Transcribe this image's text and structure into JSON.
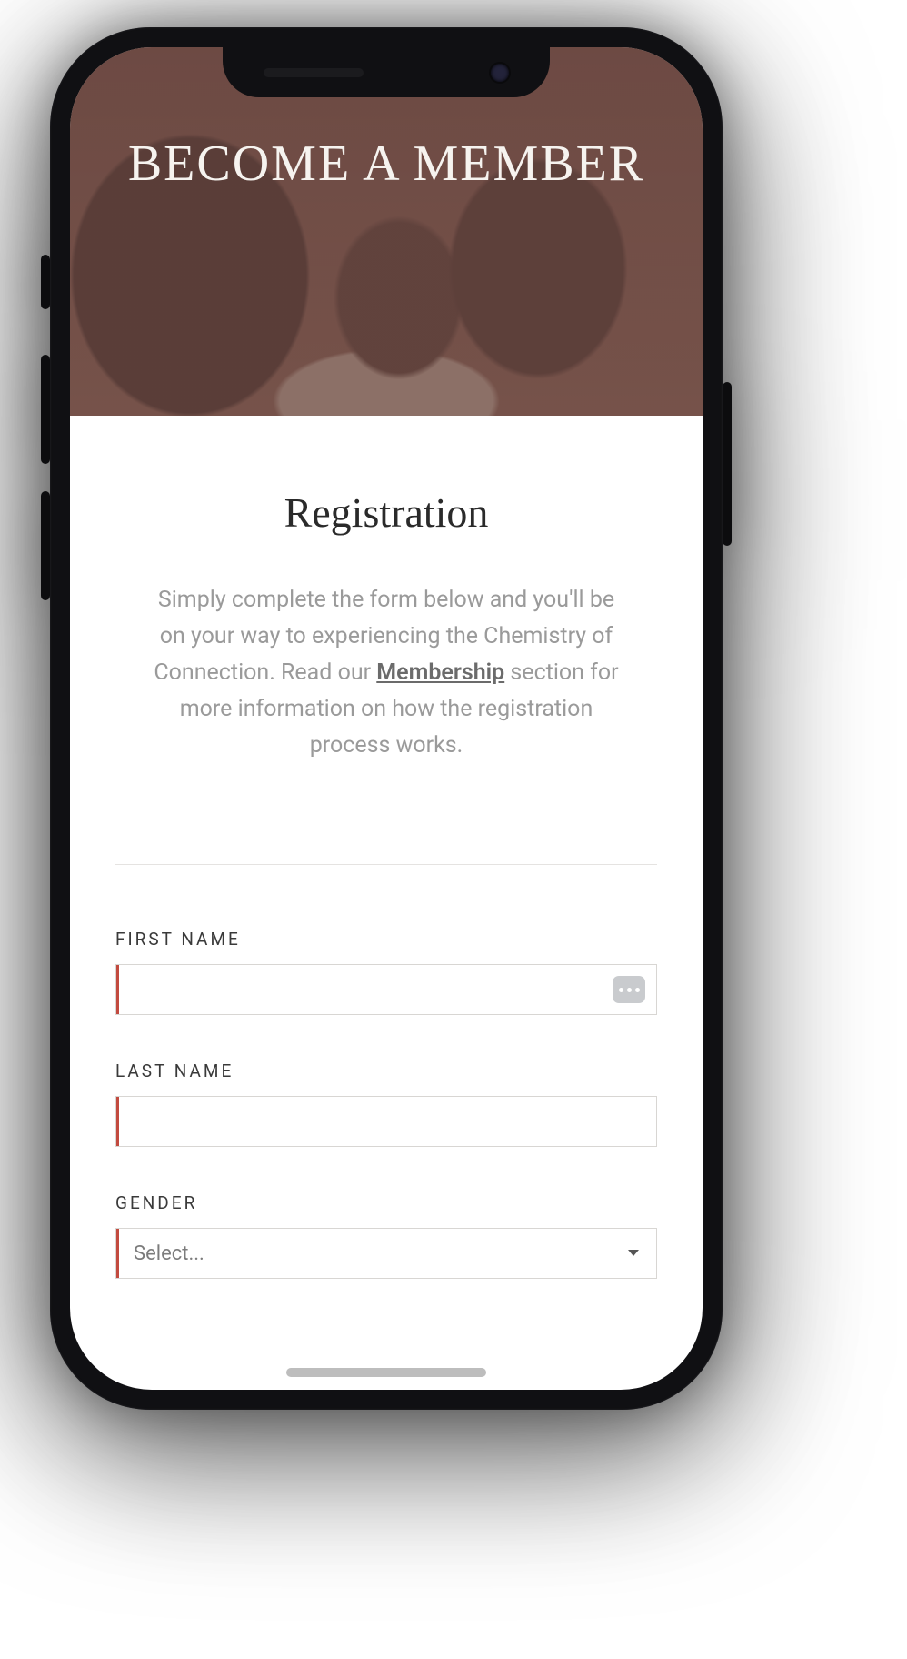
{
  "hero": {
    "title": "BECOME A MEMBER"
  },
  "section": {
    "title": "Registration",
    "intro_before_link": "Simply complete the form below and you'll be on your way to experiencing the Chemistry of Connection. Read our ",
    "link_text": "Membership",
    "intro_after_link": " section for more information on how the registration process works."
  },
  "form": {
    "first_name": {
      "label": "FIRST NAME",
      "value": ""
    },
    "last_name": {
      "label": "LAST NAME",
      "value": ""
    },
    "gender": {
      "label": "GENDER",
      "selected": "Select..."
    }
  }
}
